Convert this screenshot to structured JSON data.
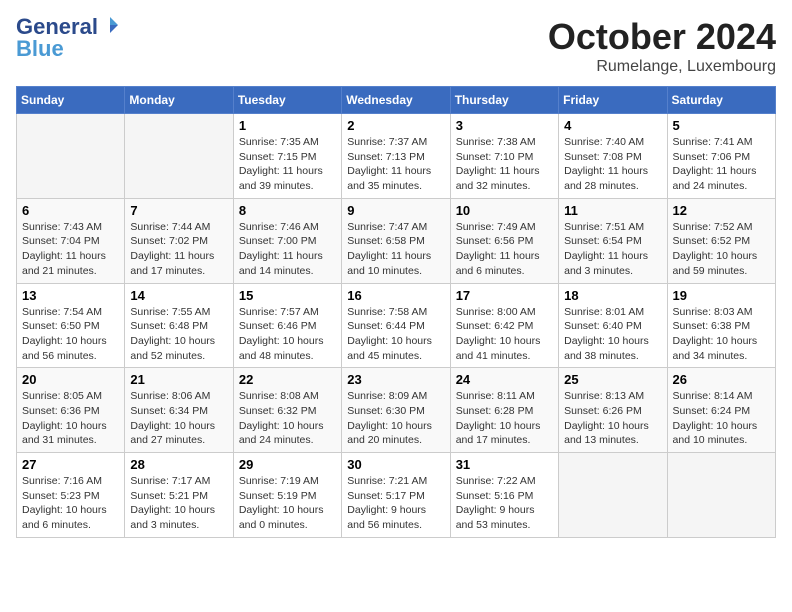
{
  "header": {
    "logo_general": "General",
    "logo_blue": "Blue",
    "month": "October 2024",
    "location": "Rumelange, Luxembourg"
  },
  "columns": [
    "Sunday",
    "Monday",
    "Tuesday",
    "Wednesday",
    "Thursday",
    "Friday",
    "Saturday"
  ],
  "weeks": [
    [
      {
        "day": "",
        "info": ""
      },
      {
        "day": "",
        "info": ""
      },
      {
        "day": "1",
        "info": "Sunrise: 7:35 AM\nSunset: 7:15 PM\nDaylight: 11 hours and 39 minutes."
      },
      {
        "day": "2",
        "info": "Sunrise: 7:37 AM\nSunset: 7:13 PM\nDaylight: 11 hours and 35 minutes."
      },
      {
        "day": "3",
        "info": "Sunrise: 7:38 AM\nSunset: 7:10 PM\nDaylight: 11 hours and 32 minutes."
      },
      {
        "day": "4",
        "info": "Sunrise: 7:40 AM\nSunset: 7:08 PM\nDaylight: 11 hours and 28 minutes."
      },
      {
        "day": "5",
        "info": "Sunrise: 7:41 AM\nSunset: 7:06 PM\nDaylight: 11 hours and 24 minutes."
      }
    ],
    [
      {
        "day": "6",
        "info": "Sunrise: 7:43 AM\nSunset: 7:04 PM\nDaylight: 11 hours and 21 minutes."
      },
      {
        "day": "7",
        "info": "Sunrise: 7:44 AM\nSunset: 7:02 PM\nDaylight: 11 hours and 17 minutes."
      },
      {
        "day": "8",
        "info": "Sunrise: 7:46 AM\nSunset: 7:00 PM\nDaylight: 11 hours and 14 minutes."
      },
      {
        "day": "9",
        "info": "Sunrise: 7:47 AM\nSunset: 6:58 PM\nDaylight: 11 hours and 10 minutes."
      },
      {
        "day": "10",
        "info": "Sunrise: 7:49 AM\nSunset: 6:56 PM\nDaylight: 11 hours and 6 minutes."
      },
      {
        "day": "11",
        "info": "Sunrise: 7:51 AM\nSunset: 6:54 PM\nDaylight: 11 hours and 3 minutes."
      },
      {
        "day": "12",
        "info": "Sunrise: 7:52 AM\nSunset: 6:52 PM\nDaylight: 10 hours and 59 minutes."
      }
    ],
    [
      {
        "day": "13",
        "info": "Sunrise: 7:54 AM\nSunset: 6:50 PM\nDaylight: 10 hours and 56 minutes."
      },
      {
        "day": "14",
        "info": "Sunrise: 7:55 AM\nSunset: 6:48 PM\nDaylight: 10 hours and 52 minutes."
      },
      {
        "day": "15",
        "info": "Sunrise: 7:57 AM\nSunset: 6:46 PM\nDaylight: 10 hours and 48 minutes."
      },
      {
        "day": "16",
        "info": "Sunrise: 7:58 AM\nSunset: 6:44 PM\nDaylight: 10 hours and 45 minutes."
      },
      {
        "day": "17",
        "info": "Sunrise: 8:00 AM\nSunset: 6:42 PM\nDaylight: 10 hours and 41 minutes."
      },
      {
        "day": "18",
        "info": "Sunrise: 8:01 AM\nSunset: 6:40 PM\nDaylight: 10 hours and 38 minutes."
      },
      {
        "day": "19",
        "info": "Sunrise: 8:03 AM\nSunset: 6:38 PM\nDaylight: 10 hours and 34 minutes."
      }
    ],
    [
      {
        "day": "20",
        "info": "Sunrise: 8:05 AM\nSunset: 6:36 PM\nDaylight: 10 hours and 31 minutes."
      },
      {
        "day": "21",
        "info": "Sunrise: 8:06 AM\nSunset: 6:34 PM\nDaylight: 10 hours and 27 minutes."
      },
      {
        "day": "22",
        "info": "Sunrise: 8:08 AM\nSunset: 6:32 PM\nDaylight: 10 hours and 24 minutes."
      },
      {
        "day": "23",
        "info": "Sunrise: 8:09 AM\nSunset: 6:30 PM\nDaylight: 10 hours and 20 minutes."
      },
      {
        "day": "24",
        "info": "Sunrise: 8:11 AM\nSunset: 6:28 PM\nDaylight: 10 hours and 17 minutes."
      },
      {
        "day": "25",
        "info": "Sunrise: 8:13 AM\nSunset: 6:26 PM\nDaylight: 10 hours and 13 minutes."
      },
      {
        "day": "26",
        "info": "Sunrise: 8:14 AM\nSunset: 6:24 PM\nDaylight: 10 hours and 10 minutes."
      }
    ],
    [
      {
        "day": "27",
        "info": "Sunrise: 7:16 AM\nSunset: 5:23 PM\nDaylight: 10 hours and 6 minutes."
      },
      {
        "day": "28",
        "info": "Sunrise: 7:17 AM\nSunset: 5:21 PM\nDaylight: 10 hours and 3 minutes."
      },
      {
        "day": "29",
        "info": "Sunrise: 7:19 AM\nSunset: 5:19 PM\nDaylight: 10 hours and 0 minutes."
      },
      {
        "day": "30",
        "info": "Sunrise: 7:21 AM\nSunset: 5:17 PM\nDaylight: 9 hours and 56 minutes."
      },
      {
        "day": "31",
        "info": "Sunrise: 7:22 AM\nSunset: 5:16 PM\nDaylight: 9 hours and 53 minutes."
      },
      {
        "day": "",
        "info": ""
      },
      {
        "day": "",
        "info": ""
      }
    ]
  ]
}
